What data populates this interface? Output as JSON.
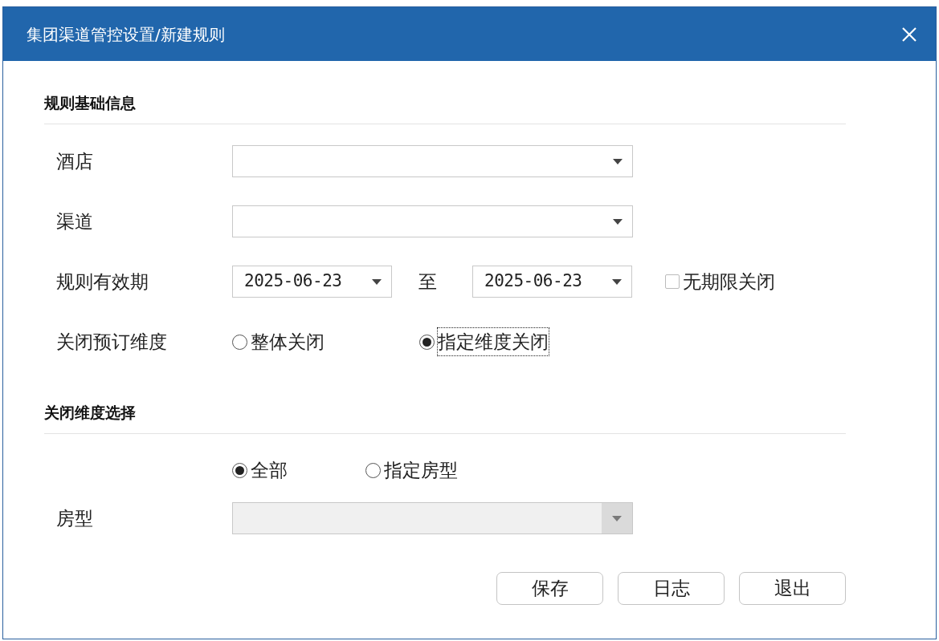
{
  "window": {
    "title": "集团渠道管控设置/新建规则"
  },
  "basic_info": {
    "title": "规则基础信息",
    "hotel": {
      "label": "酒店"
    },
    "channel": {
      "label": "渠道"
    },
    "validity": {
      "label": "规则有效期",
      "start": "2025-06-23",
      "separator": "至",
      "end": "2025-06-23",
      "no_limit": {
        "label": "无期限关闭",
        "checked": false
      }
    },
    "close_dimension": {
      "label": "关闭预订维度",
      "options": [
        {
          "label": "整体关闭",
          "selected": false,
          "focused": false
        },
        {
          "label": "指定维度关闭",
          "selected": true,
          "focused": true
        }
      ]
    }
  },
  "dimension_selection": {
    "title": "关闭维度选择",
    "scope": [
      {
        "label": "全部",
        "selected": true
      },
      {
        "label": "指定房型",
        "selected": false
      }
    ],
    "room_type": {
      "label": "房型",
      "disabled": true
    }
  },
  "buttons": [
    "保存",
    "日志",
    "退出"
  ]
}
